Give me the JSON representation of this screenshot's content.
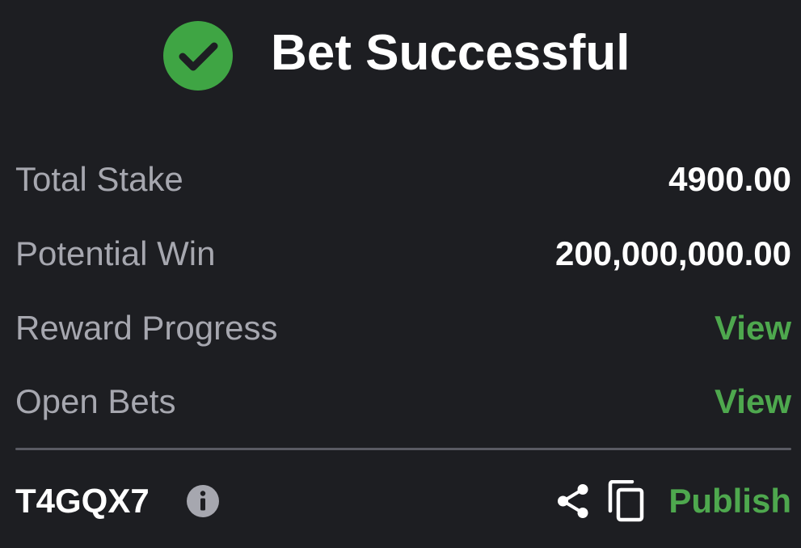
{
  "header": {
    "title": "Bet Successful",
    "icon": "check-circle-icon"
  },
  "summary": {
    "rows": [
      {
        "label": "Total Stake",
        "value": "4900.00"
      },
      {
        "label": "Potential Win",
        "value": "200,000,000.00"
      },
      {
        "label": "Reward Progress",
        "value": "View"
      },
      {
        "label": "Open Bets",
        "value": "View"
      }
    ]
  },
  "footer": {
    "booking_code": "T4GQX7",
    "info_icon": "info-icon",
    "share_icon": "share-icon",
    "copy_icon": "copy-icon",
    "publish_label": "Publish"
  },
  "colors": {
    "background": "#1d1e22",
    "accent_green": "#4ea84e",
    "check_green": "#3fa544",
    "label_gray": "#a6a7af",
    "text_white": "#ffffff"
  }
}
